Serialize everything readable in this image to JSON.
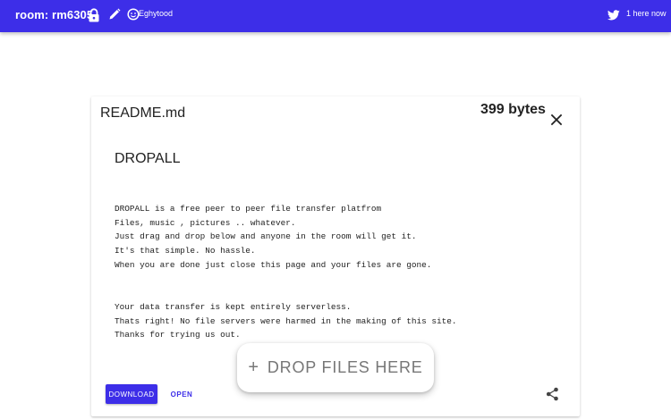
{
  "header": {
    "room_label": "room: rm6305",
    "username": "Eghytood",
    "here_count": "1 here now",
    "bar_color": "#3d2ee8",
    "icons": [
      "lock-icon",
      "pencil-icon",
      "avatar-icon",
      "twitter-icon"
    ]
  },
  "file": {
    "name": "README.md",
    "size": "399 bytes",
    "title": "DROPALL",
    "lines": [
      "DROPALL is a free peer to peer file transfer platfrom",
      "Files, music , pictures .. whatever.",
      "Just drag and drop below and anyone in the room will get it.",
      "It's that simple. No hassle.",
      "When you are done just close this page and your files are gone.",
      "Your data transfer is kept entirely serverless.",
      "Thats right! No file servers were harmed in the making of this site.",
      "Thanks for trying us out."
    ]
  },
  "actions": {
    "download_label": "DOWNLOAD",
    "open_label": "OPEN",
    "icons": [
      "close-icon",
      "share-icon"
    ]
  },
  "drop": {
    "plus": "+",
    "label": "DROP FILES HERE"
  }
}
